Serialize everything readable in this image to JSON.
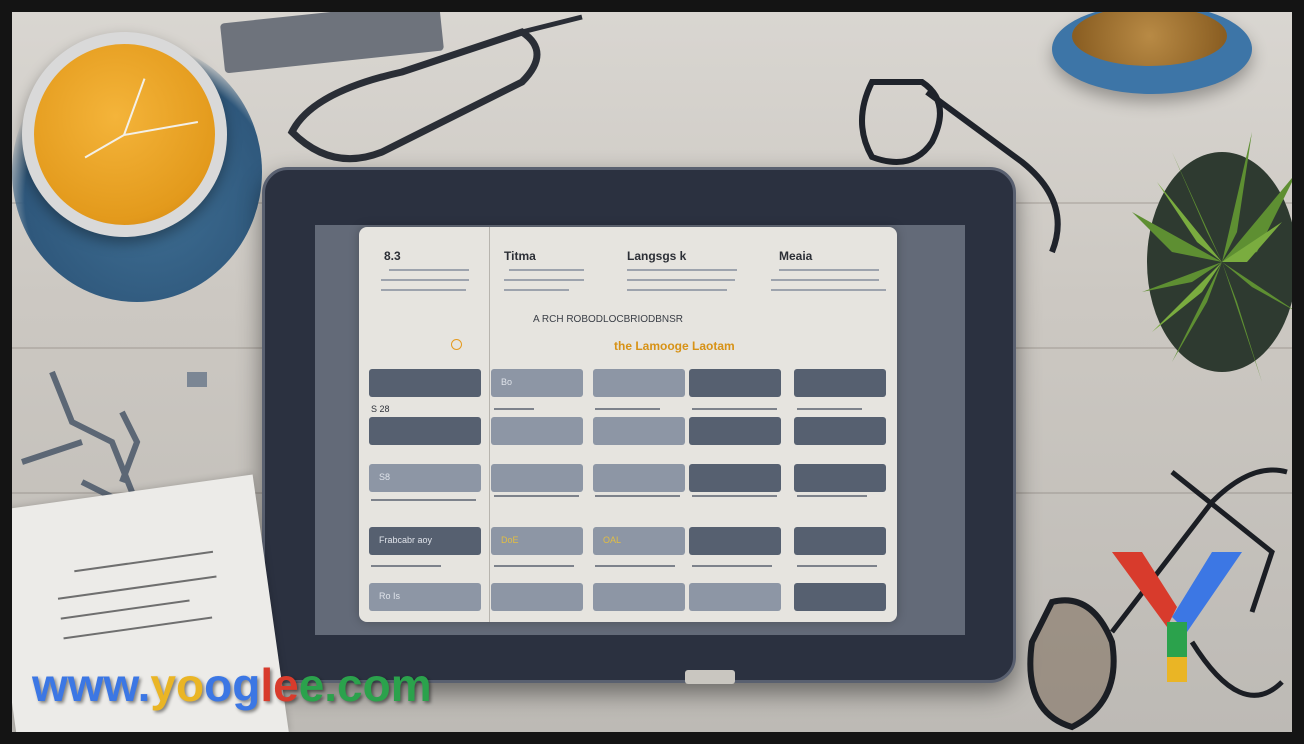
{
  "scene": {
    "description_color_palette": {
      "desk": "#d3cfca",
      "tablet_frame": "#2b3140",
      "accent_orange": "#d79216",
      "cell_dark": "#566070",
      "cell_light": "#8d96a5"
    }
  },
  "document": {
    "col_headers": [
      "8.3",
      "Titma",
      "Langsgs k",
      "Meaia"
    ],
    "banner_text": "A RCH ROBODLOCBRIODBNSR",
    "orange_text": "the Lamooge Laotam",
    "rows": [
      {
        "label": "",
        "cells": [
          "",
          "Bo",
          "",
          "",
          ""
        ]
      },
      {
        "label": "S 28",
        "cells": [
          "",
          "",
          "",
          "",
          ""
        ]
      },
      {
        "label": "",
        "cells": [
          "",
          "",
          "",
          "",
          ""
        ]
      },
      {
        "label": "",
        "cells": [
          "S8",
          "",
          "",
          "",
          ""
        ]
      },
      {
        "label": "",
        "cells": [
          "Frabcabr aoy",
          "DoE",
          "OAL",
          "",
          ""
        ]
      },
      {
        "label": "",
        "cells": [
          "Ro Is",
          "",
          "",
          "",
          ""
        ]
      }
    ]
  },
  "watermark": {
    "part1": "www.",
    "part2": "yo",
    "part3": "og",
    "part4": "le",
    "part5": "e.com"
  },
  "icons": {
    "clock": "clock-icon",
    "glasses": "glasses-icon",
    "coffee": "coffee-cup-icon",
    "plant": "plant-icon",
    "logo": "y-logo-icon"
  }
}
